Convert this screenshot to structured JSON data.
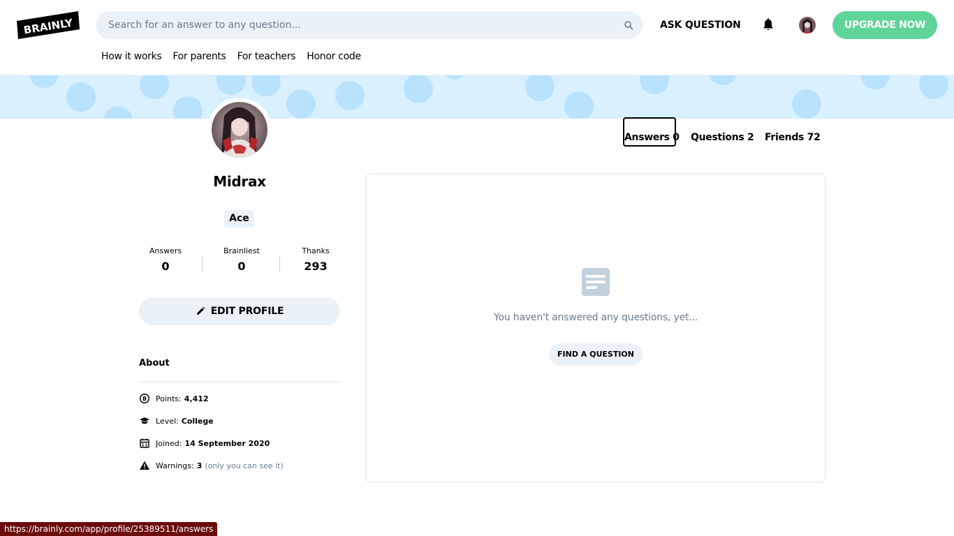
{
  "header": {
    "logo_text": "BRAINLY",
    "search_placeholder": "Search for an answer to any question...",
    "ask_question": "ASK QUESTION",
    "upgrade": "UPGRADE NOW",
    "nav": [
      "How it works",
      "For parents",
      "For teachers",
      "Honor code"
    ]
  },
  "profile": {
    "username": "Midrax",
    "rank": "Ace",
    "stats": [
      {
        "label": "Answers",
        "value": "0"
      },
      {
        "label": "Brainliest",
        "value": "0"
      },
      {
        "label": "Thanks",
        "value": "293"
      }
    ],
    "edit_profile": "EDIT PROFILE"
  },
  "about": {
    "title": "About",
    "points_label": "Points:",
    "points_value": "4,412",
    "level_label": "Level:",
    "level_value": "College",
    "joined_label": "Joined:",
    "joined_value": "14 September 2020",
    "warnings_label": "Warnings:",
    "warnings_value": "3",
    "warnings_note": "(only you can see it)"
  },
  "tabs": [
    {
      "label": "Answers 0",
      "active": true
    },
    {
      "label": "Questions 2",
      "active": false
    },
    {
      "label": "Friends 72",
      "active": false
    }
  ],
  "content": {
    "empty_message": "You haven't answered any questions, yet...",
    "find_question": "FIND A QUESTION"
  },
  "status_url": "https://brainly.com/app/profile/25389511/answers",
  "colors": {
    "accent_green": "#60d399",
    "banner_bg": "#d9f0ff",
    "banner_dots": "#b9e2fe",
    "muted_text": "#687b8c",
    "light_gray": "#ebf2f7",
    "status_bar": "#6b0c0c"
  }
}
